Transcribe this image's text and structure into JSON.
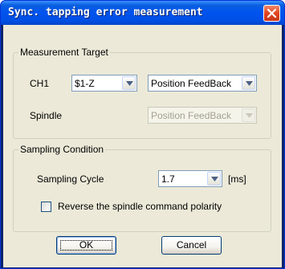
{
  "window": {
    "title": "Sync. tapping error measurement"
  },
  "measurement_target": {
    "legend": "Measurement Target",
    "ch1_label": "CH1",
    "ch1_axis_value": "$1-Z",
    "ch1_type_value": "Position FeedBack",
    "spindle_label": "Spindle",
    "spindle_type_value": "Position FeedBack"
  },
  "sampling_condition": {
    "legend": "Sampling Condition",
    "cycle_label": "Sampling Cycle",
    "cycle_value": "1.7",
    "cycle_unit": "[ms]",
    "reverse_label": "Reverse the spindle command polarity",
    "reverse_checked": false
  },
  "buttons": {
    "ok": "OK",
    "cancel": "Cancel"
  },
  "colors": {
    "titlebar": "#0053ee",
    "dialog_bg": "#ece9d8",
    "close": "#e3441e"
  }
}
